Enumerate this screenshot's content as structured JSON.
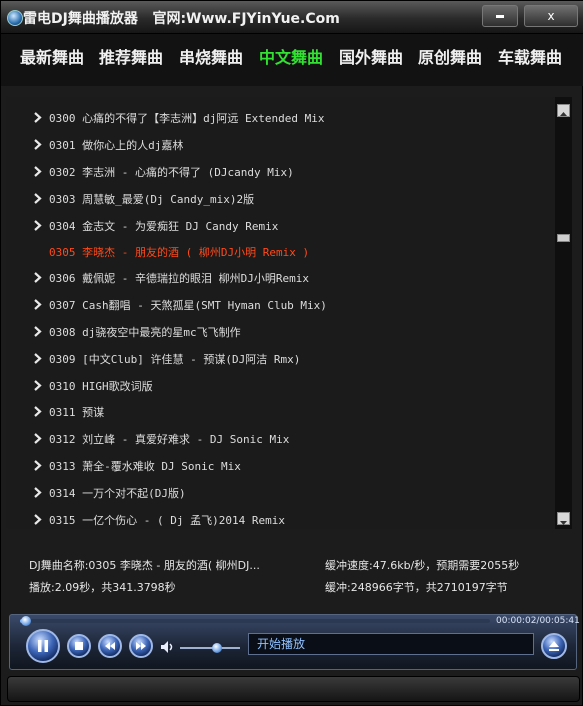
{
  "window": {
    "title": "雷电DJ舞曲播放器   官网:Www.FJYinYue.Com",
    "close_label": "x"
  },
  "nav": {
    "tabs": [
      {
        "label": "最新舞曲",
        "active": false
      },
      {
        "label": "推荐舞曲",
        "active": false
      },
      {
        "label": "串烧舞曲",
        "active": false
      },
      {
        "label": "中文舞曲",
        "active": true
      },
      {
        "label": "国外舞曲",
        "active": false
      },
      {
        "label": "原创舞曲",
        "active": false
      },
      {
        "label": "车载舞曲",
        "active": false
      }
    ]
  },
  "playlist": {
    "items": [
      {
        "text": "0300 心痛的不得了【李志洲】dj阿远 Extended Mix",
        "current": false
      },
      {
        "text": "0301 做你心上的人dj嘉林",
        "current": false
      },
      {
        "text": "0302 李志洲 - 心痛的不得了 (DJcandy Mix)",
        "current": false
      },
      {
        "text": "0303 周慧敏_最爱(Dj Candy_mix)2版",
        "current": false
      },
      {
        "text": "0304 金志文 - 为爱痴狂 DJ Candy Remix",
        "current": false
      },
      {
        "text": "0305 李晓杰 - 朋友的酒 ( 柳州DJ小明 Remix )",
        "current": true
      },
      {
        "text": "0306 戴佩妮 - 辛德瑞拉的眼泪 柳州DJ小明Remix",
        "current": false
      },
      {
        "text": "0307 Cash翻唱 - 天煞孤星(SMT Hyman Club Mix)",
        "current": false
      },
      {
        "text": "0308 dj骁夜空中最亮的星mc飞飞制作",
        "current": false
      },
      {
        "text": "0309 [中文Club] 许佳慧 - 预谋(DJ阿洁 Rmx)",
        "current": false
      },
      {
        "text": "0310 HIGH歌改词版",
        "current": false
      },
      {
        "text": "0311 预谋",
        "current": false
      },
      {
        "text": "0312 刘立峰 - 真爱好难求 - DJ Sonic Mix",
        "current": false
      },
      {
        "text": "0313 萧全-覆水难收 DJ Sonic Mix",
        "current": false
      },
      {
        "text": "0314 一万个对不起(DJ版)",
        "current": false
      },
      {
        "text": "0315 一亿个伤心 - ( Dj 孟飞)2014 Remix",
        "current": false
      }
    ],
    "scroll_position": 0.3
  },
  "info": {
    "track_name": "DJ舞曲名称:0305 李晓杰 - 朋友的酒( 柳州DJ...",
    "buffer_speed": "缓冲速度:47.6kb/秒，预期需要2055秒",
    "playback": "播放:2.09秒，共341.3798秒",
    "buffer_bytes": "缓冲:248966字节，共2710197字节"
  },
  "player": {
    "time": "00:00:02/00:05:41",
    "progress": 0.006,
    "volume": 0.62,
    "status": "开始播放"
  }
}
